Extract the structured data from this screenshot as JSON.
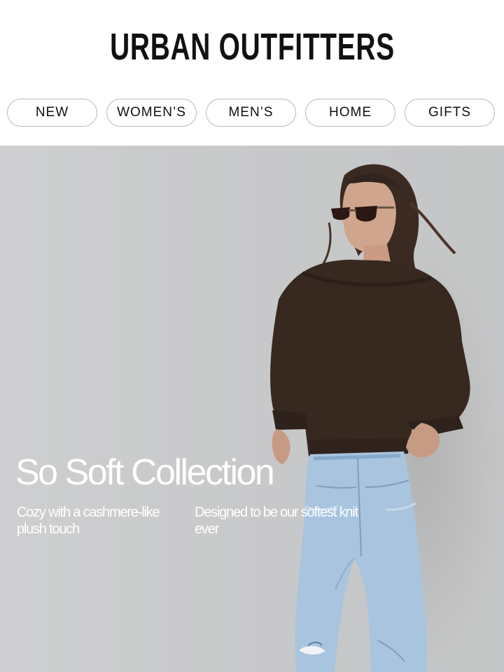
{
  "brand": {
    "logo_text": "URBAN OUTFITTERS"
  },
  "nav": {
    "items": [
      {
        "label": "NEW"
      },
      {
        "label": "WOMEN’S"
      },
      {
        "label": "MEN’S"
      },
      {
        "label": "HOME"
      },
      {
        "label": "GIFTS"
      }
    ]
  },
  "hero": {
    "headline": "So Soft Collection",
    "subcopy_left": "Cozy with a cashmere-like plush touch",
    "subcopy_right": "Designed to be our  softest knit ever",
    "colors": {
      "background": "#c9cacb",
      "sweater": "#3a2a20",
      "jeans": "#a9c4df",
      "text": "#ffffff"
    }
  }
}
